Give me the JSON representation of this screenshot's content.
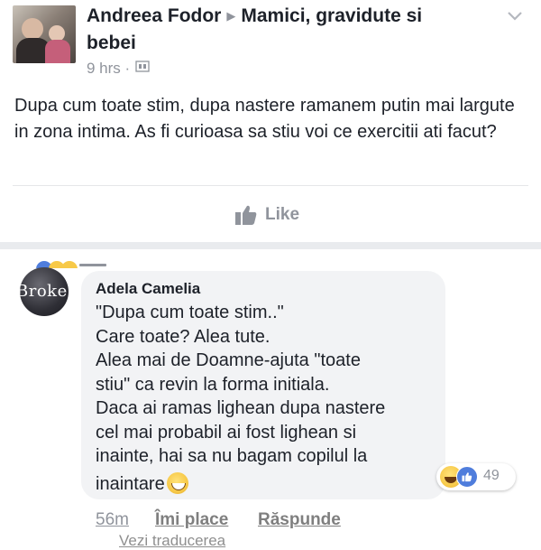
{
  "post": {
    "author": "Andreea Fodor",
    "group": "Mamici, gravidute si bebei",
    "group_line1": "Mamici, gravidute si",
    "group_line2": "bebei",
    "time": "9 hrs",
    "body": "Dupa cum toate stim,  dupa nastere ramanem putin mai largute in zona intima.  As fi curioasa sa stiu voi ce exercitii ati facut?",
    "like_label": "Like"
  },
  "comment": {
    "avatar_text": "Broke",
    "author": "Adela Camelia",
    "lines": [
      "\"Dupa cum toate stim..\"",
      "Care toate? Alea tute.",
      "Alea mai de Doamne-ajuta \"toate",
      "stiu\" ca revin la forma initiala.",
      "Daca ai ramas lighean dupa nastere",
      "cel mai probabil ai fost lighean si",
      "inainte, hai sa nu bagam copilul la",
      "inaintare"
    ],
    "reaction_count": "49",
    "time": "56m",
    "like_action": "Îmi place",
    "reply_action": "Răspunde",
    "translate": "Vezi traducerea"
  },
  "colors": {
    "text": "#1d2129",
    "meta": "#90949c",
    "bubble": "#f2f3f5",
    "like_blue": "#4f7ddc"
  }
}
